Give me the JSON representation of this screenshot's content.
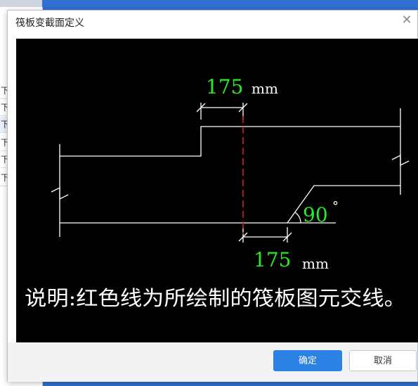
{
  "background": {
    "left_rows": [
      "下",
      "下",
      "下",
      "下",
      "下",
      "下"
    ]
  },
  "dialog": {
    "title": "筏板变截面定义",
    "close_icon": "close-icon",
    "buttons": {
      "ok": "确定",
      "cancel": "取消"
    }
  },
  "drawing": {
    "top_dim_value": "175",
    "top_dim_unit": "mm",
    "bottom_dim_value": "175",
    "bottom_dim_unit": "mm",
    "angle_value": "90",
    "angle_unit": "°",
    "note": "说明:红色线为所绘制的筏板图元交线。",
    "colors": {
      "line": "#ffffff",
      "value": "#22ee22",
      "cut_line": "#e02020",
      "background": "#000000"
    }
  }
}
